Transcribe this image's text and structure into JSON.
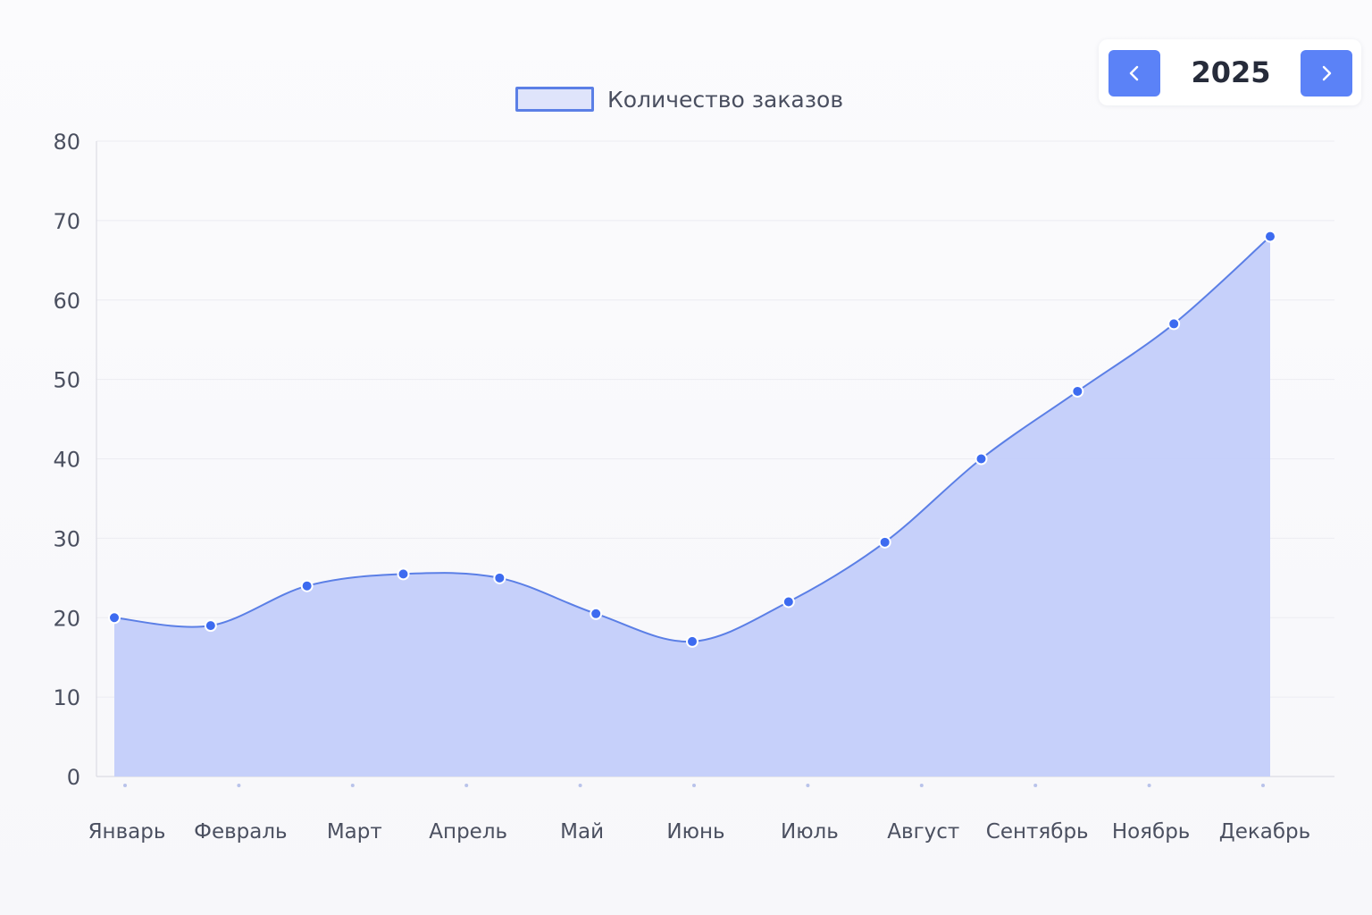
{
  "chart_data": {
    "type": "area",
    "categories": [
      "Январь",
      "Февраль",
      "Март",
      "Апрель",
      "Май",
      "Июнь",
      "Июль",
      "Август",
      "Сентябрь",
      "Ноябрь",
      "Декабрь"
    ],
    "series": [
      {
        "name": "Количество заказов",
        "values": [
          20,
          19,
          24,
          25.5,
          25,
          20.5,
          17,
          22,
          29.5,
          40,
          48.5,
          57,
          68
        ]
      }
    ],
    "ylim": [
      0,
      80
    ],
    "yticks": [
      0,
      10,
      20,
      30,
      40,
      50,
      60,
      70,
      80
    ],
    "grid": true,
    "legend": "top-center",
    "colors": {
      "line": "#5b7fe6",
      "fill": "#c3cdfa",
      "point": "#3d6bf0",
      "legend_fill": "#dfe4fb"
    }
  },
  "year_selector": {
    "year": "2025",
    "prev_icon": "chevron-left-icon",
    "next_icon": "chevron-right-icon",
    "button_color": "#5b82f7"
  }
}
